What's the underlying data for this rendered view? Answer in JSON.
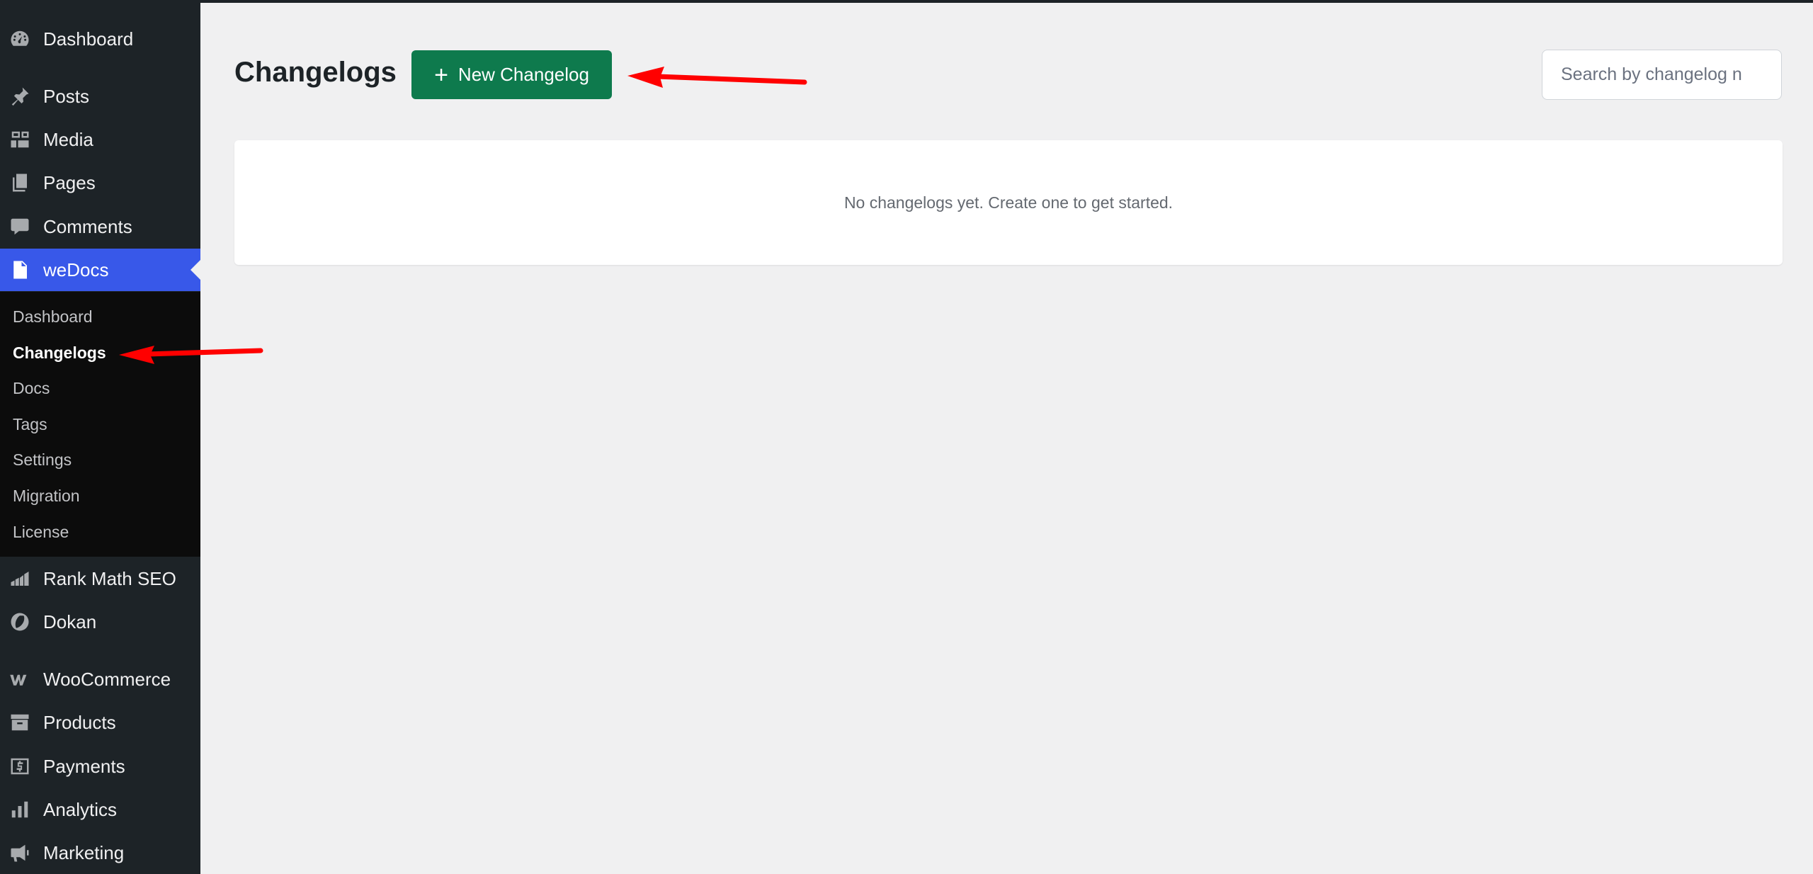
{
  "sidebar": {
    "items": [
      {
        "label": "Dashboard",
        "icon": "dashboard-icon"
      },
      {
        "label": "Posts",
        "icon": "pin-icon"
      },
      {
        "label": "Media",
        "icon": "media-icon"
      },
      {
        "label": "Pages",
        "icon": "pages-icon"
      },
      {
        "label": "Comments",
        "icon": "comment-icon"
      },
      {
        "label": "weDocs",
        "icon": "document-icon"
      },
      {
        "label": "Rank Math SEO",
        "icon": "rank-math-icon"
      },
      {
        "label": "Dokan",
        "icon": "dokan-icon"
      },
      {
        "label": "WooCommerce",
        "icon": "woocommerce-icon"
      },
      {
        "label": "Products",
        "icon": "archive-icon"
      },
      {
        "label": "Payments",
        "icon": "dollar-icon"
      },
      {
        "label": "Analytics",
        "icon": "bar-chart-icon"
      },
      {
        "label": "Marketing",
        "icon": "megaphone-icon"
      }
    ],
    "submenu": [
      {
        "label": "Dashboard"
      },
      {
        "label": "Changelogs"
      },
      {
        "label": "Docs"
      },
      {
        "label": "Tags"
      },
      {
        "label": "Settings"
      },
      {
        "label": "Migration"
      },
      {
        "label": "License"
      }
    ]
  },
  "main": {
    "title": "Changelogs",
    "new_button_label": "New Changelog",
    "search_placeholder": "Search by changelog n",
    "empty_message": "No changelogs yet. Create one to get started."
  },
  "colors": {
    "sidebar_bg": "#1d2327",
    "active_menu": "#3858e9",
    "primary_button": "#0e7a4d",
    "annotation_arrow": "#ff0000"
  }
}
